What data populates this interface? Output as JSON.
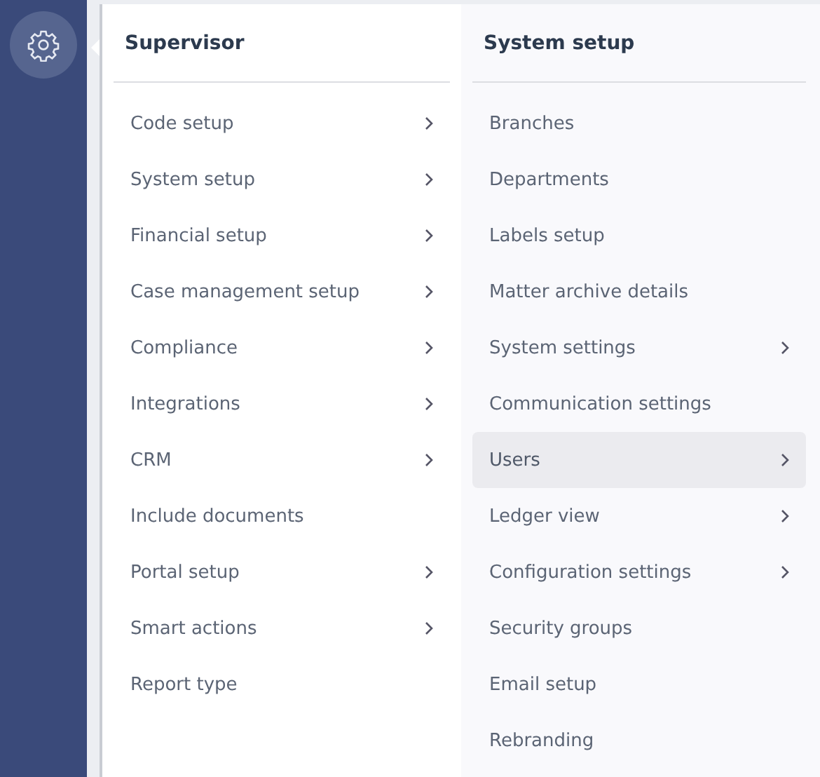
{
  "sidebar": {
    "settings_active": true
  },
  "menu": {
    "title": "Supervisor",
    "items": [
      {
        "label": "Code setup",
        "has_submenu": true
      },
      {
        "label": "System setup",
        "has_submenu": true
      },
      {
        "label": "Financial setup",
        "has_submenu": true
      },
      {
        "label": "Case management setup",
        "has_submenu": true
      },
      {
        "label": "Compliance",
        "has_submenu": true
      },
      {
        "label": "Integrations",
        "has_submenu": true
      },
      {
        "label": "CRM",
        "has_submenu": true
      },
      {
        "label": "Include documents",
        "has_submenu": false
      },
      {
        "label": "Portal setup",
        "has_submenu": true
      },
      {
        "label": "Smart actions",
        "has_submenu": true
      },
      {
        "label": "Report type",
        "has_submenu": false
      }
    ]
  },
  "submenu": {
    "title": "System setup",
    "items": [
      {
        "label": "Branches",
        "has_submenu": false,
        "selected": false
      },
      {
        "label": "Departments",
        "has_submenu": false,
        "selected": false
      },
      {
        "label": "Labels setup",
        "has_submenu": false,
        "selected": false
      },
      {
        "label": "Matter archive details",
        "has_submenu": false,
        "selected": false
      },
      {
        "label": "System settings",
        "has_submenu": true,
        "selected": false
      },
      {
        "label": "Communication settings",
        "has_submenu": false,
        "selected": false
      },
      {
        "label": "Users",
        "has_submenu": true,
        "selected": true
      },
      {
        "label": "Ledger view",
        "has_submenu": true,
        "selected": false
      },
      {
        "label": "Configuration settings",
        "has_submenu": true,
        "selected": false
      },
      {
        "label": "Security groups",
        "has_submenu": false,
        "selected": false
      },
      {
        "label": "Email setup",
        "has_submenu": false,
        "selected": false
      },
      {
        "label": "Rebranding",
        "has_submenu": false,
        "selected": false
      }
    ]
  }
}
